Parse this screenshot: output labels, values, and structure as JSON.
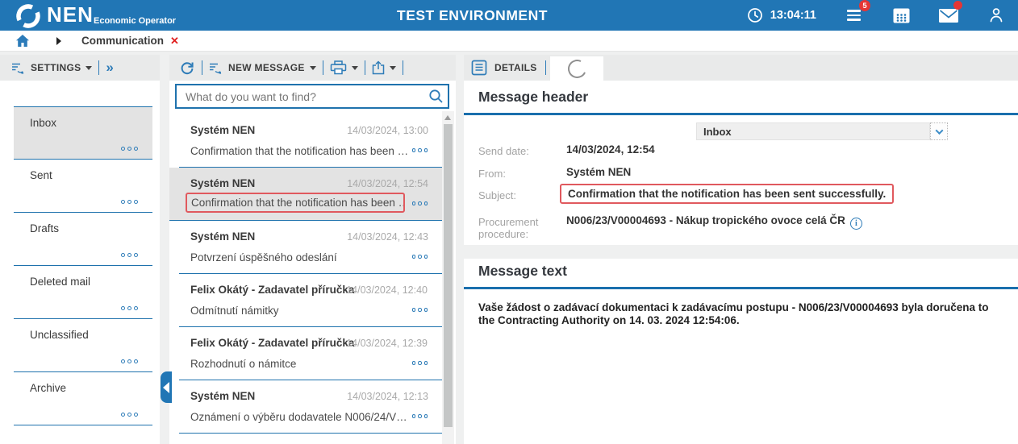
{
  "header": {
    "logo_text": "NEN",
    "logo_subtitle": "Economic Operator",
    "title": "TEST ENVIRONMENT",
    "time": "13:04:11",
    "notifications_badge": "5"
  },
  "breadcrumb": {
    "item": "Communication"
  },
  "icons": {
    "close": "✕",
    "double_chevron": "»"
  },
  "sidebar": {
    "settings_label": "SETTINGS",
    "folders": [
      {
        "label": "Inbox",
        "selected": true
      },
      {
        "label": "Sent",
        "selected": false
      },
      {
        "label": "Drafts",
        "selected": false
      },
      {
        "label": "Deleted mail",
        "selected": false
      },
      {
        "label": "Unclassified",
        "selected": false
      },
      {
        "label": "Archive",
        "selected": false
      }
    ]
  },
  "message_list": {
    "new_message_label": "NEW MESSAGE",
    "search_placeholder": "What do you want to find?",
    "items": [
      {
        "sender": "Systém NEN",
        "date": "14/03/2024, 13:00",
        "subject": "Confirmation that the notification has been …",
        "selected": false,
        "highlighted": false
      },
      {
        "sender": "Systém NEN",
        "date": "14/03/2024, 12:54",
        "subject": "Confirmation that the notification has been …",
        "selected": true,
        "highlighted": true
      },
      {
        "sender": "Systém NEN",
        "date": "14/03/2024, 12:43",
        "subject": "Potvrzení úspěšného odeslání",
        "selected": false,
        "highlighted": false
      },
      {
        "sender": "Felix Okátý - Zadavatel příručka",
        "date": "14/03/2024, 12:40",
        "subject": "Odmítnutí námitky",
        "selected": false,
        "highlighted": false
      },
      {
        "sender": "Felix Okátý - Zadavatel příručka",
        "date": "14/03/2024, 12:39",
        "subject": "Rozhodnutí o námitce",
        "selected": false,
        "highlighted": false
      },
      {
        "sender": "Systém NEN",
        "date": "14/03/2024, 12:13",
        "subject": "Oznámení o výběru dodavatele N006/24/V…",
        "selected": false,
        "highlighted": false
      }
    ]
  },
  "details": {
    "tab_label": "DETAILS",
    "header_section_title": "Message header",
    "folder_select_value": "Inbox",
    "info_icon_glyph": "i",
    "fields": [
      {
        "label": "Send date:",
        "value": "14/03/2024, 12:54"
      },
      {
        "label": "From:",
        "value": "Systém NEN"
      },
      {
        "label": "Subject:",
        "value": "Confirmation that the notification has been sent successfully.",
        "highlighted": true
      },
      {
        "label": "Procurement procedure:",
        "value": "N006/23/V00004693 - Nákup tropického ovoce celá ČR"
      }
    ],
    "text_section_title": "Message text",
    "message_text_lines": [
      "Vaše žádost o zadávací dokumentaci k zadávacímu postupu  - N006/23/V00004693 byla doručena to",
      "the Contracting Authority on 14. 03. 2024 12:54:06."
    ]
  },
  "colors": {
    "header_bg": "#2176b5",
    "accent_blue": "#1f72ad",
    "icon_blue": "#2e7cb8",
    "highlight_red": "#e0595e",
    "badge_red": "#e53535",
    "selected_grey": "#e3e3e3",
    "toolbar_grey": "#e9eaea",
    "label_grey": "#a3a3a3"
  }
}
